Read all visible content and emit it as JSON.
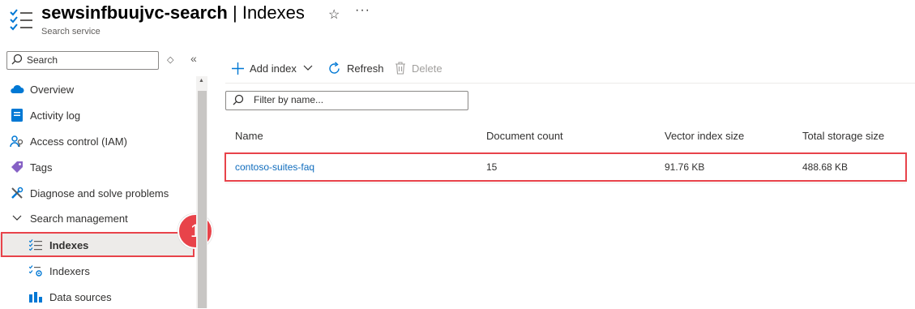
{
  "header": {
    "resource_name": "sewsinfbuujvc-search",
    "separator": " | ",
    "page_name": "Indexes",
    "subtitle": "Search service",
    "icons": [
      "indexes-list-icon",
      "star-icon",
      "more-icon"
    ]
  },
  "sidebar": {
    "search_placeholder": "Search",
    "items": [
      {
        "label": "Overview",
        "icon": "cloud-icon"
      },
      {
        "label": "Activity log",
        "icon": "activity-log-icon"
      },
      {
        "label": "Access control (IAM)",
        "icon": "people-icon"
      },
      {
        "label": "Tags",
        "icon": "tag-icon"
      },
      {
        "label": "Diagnose and solve problems",
        "icon": "wrench-icon"
      },
      {
        "label": "Search management",
        "icon": "chevron-down-icon"
      },
      {
        "label": "Indexes",
        "icon": "indexes-icon",
        "selected": true
      },
      {
        "label": "Indexers",
        "icon": "indexers-icon"
      },
      {
        "label": "Data sources",
        "icon": "data-sources-icon"
      }
    ]
  },
  "annotation": {
    "step_number": "1",
    "color": "#e8434a"
  },
  "toolbar": {
    "add_index_label": "Add index",
    "refresh_label": "Refresh",
    "delete_label": "Delete"
  },
  "filter": {
    "placeholder": "Filter by name..."
  },
  "table": {
    "columns": [
      "Name",
      "Document count",
      "Vector index size",
      "Total storage size"
    ],
    "rows": [
      {
        "name": "contoso-suites-faq",
        "document_count": "15",
        "vector_index_size": "91.76 KB",
        "total_storage_size": "488.68 KB"
      }
    ]
  },
  "colors": {
    "link": "#0f6cbd",
    "highlight": "#e8434a",
    "selected_bg": "#edebe9"
  }
}
